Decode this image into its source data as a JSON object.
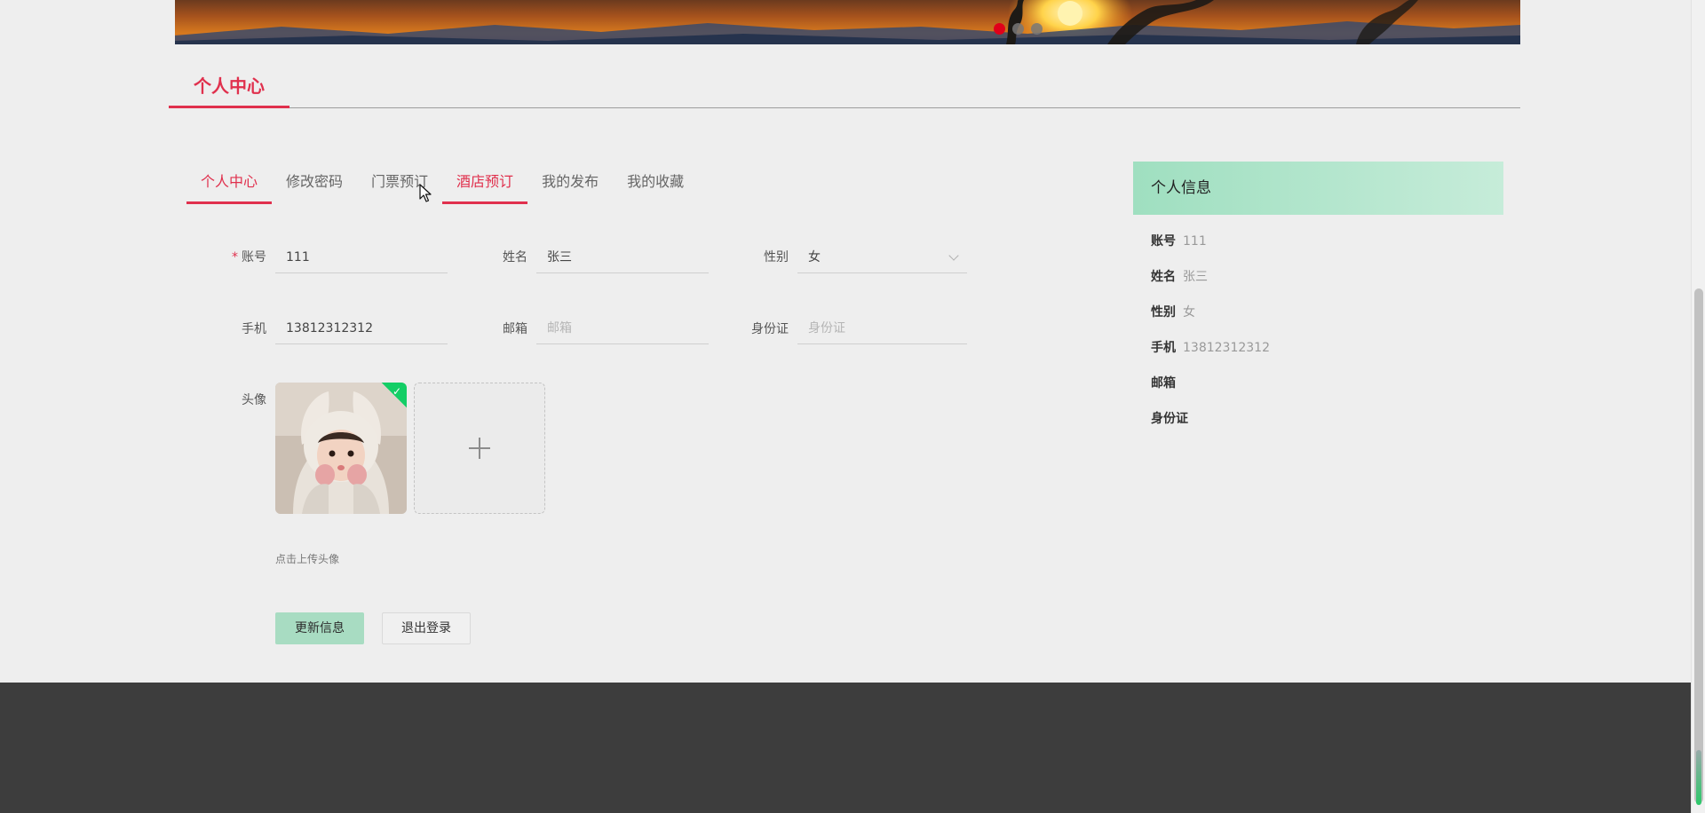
{
  "banner": {
    "slides": 3,
    "active_slide": 1
  },
  "section": {
    "title": "个人中心"
  },
  "tabs": [
    {
      "label": "个人中心",
      "state": "active"
    },
    {
      "label": "修改密码",
      "state": "normal"
    },
    {
      "label": "门票预订",
      "state": "normal"
    },
    {
      "label": "酒店预订",
      "state": "hover"
    },
    {
      "label": "我的发布",
      "state": "normal"
    },
    {
      "label": "我的收藏",
      "state": "normal"
    }
  ],
  "form": {
    "account": {
      "label": "账号",
      "required_mark": "*",
      "value": "111"
    },
    "name": {
      "label": "姓名",
      "value": "张三"
    },
    "gender": {
      "label": "性别",
      "value": "女"
    },
    "phone": {
      "label": "手机",
      "value": "13812312312"
    },
    "email": {
      "label": "邮箱",
      "placeholder": "邮箱"
    },
    "idcard": {
      "label": "身份证",
      "placeholder": "身份证"
    },
    "avatar": {
      "label": "头像",
      "hint": "点击上传头像"
    },
    "update_button": "更新信息",
    "logout_button": "退出登录"
  },
  "info": {
    "title": "个人信息",
    "rows": [
      {
        "key": "账号",
        "value": "111"
      },
      {
        "key": "姓名",
        "value": "张三"
      },
      {
        "key": "性别",
        "value": "女"
      },
      {
        "key": "手机",
        "value": "13812312312"
      },
      {
        "key": "邮箱",
        "value": ""
      },
      {
        "key": "身份证",
        "value": ""
      }
    ]
  },
  "colors": {
    "accent": "#e0304d",
    "primary_button": "#a8dcc2",
    "footer": "#3d3d3d",
    "panel_header": "#9fdfc0"
  }
}
